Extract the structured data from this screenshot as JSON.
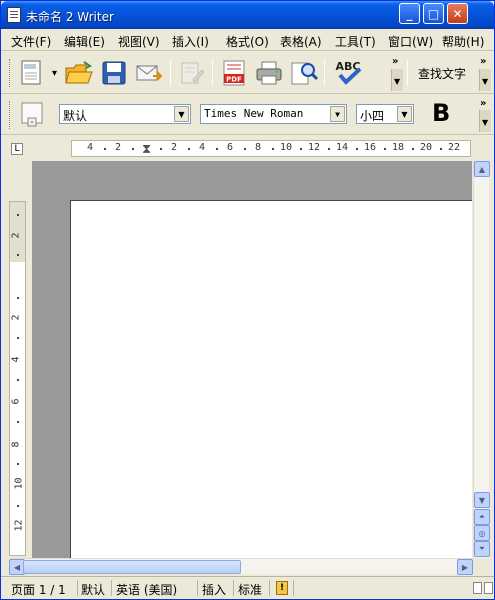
{
  "window": {
    "title": "未命名 2 Writer",
    "minimize": "_",
    "maximize": "□",
    "close": "✕"
  },
  "menu": {
    "items": [
      {
        "label": "文件(F)"
      },
      {
        "label": "编辑(E)"
      },
      {
        "label": "视图(V)"
      },
      {
        "label": "插入(I)"
      },
      {
        "label": "格式(O)"
      },
      {
        "label": "表格(A)"
      },
      {
        "label": "工具(T)"
      },
      {
        "label": "窗口(W)"
      },
      {
        "label": "帮助(H)"
      }
    ]
  },
  "standard_toolbar": {
    "new_icon": "new-document-icon",
    "open_icon": "open-folder-icon",
    "save_icon": "save-disk-icon",
    "email_icon": "email-icon",
    "edit_file_icon": "edit-file-icon",
    "pdf_label": "PDF",
    "print_icon": "printer-icon",
    "preview_icon": "page-preview-icon",
    "spellcheck_label": "ABC",
    "overflow": "»",
    "find_text_label": "查找文字"
  },
  "format_toolbar": {
    "styles_icon": "styles-icon",
    "paragraph_style": "默认",
    "font_name": "Times New Roman",
    "font_size": "小四",
    "bold_label": "B",
    "overflow": "»"
  },
  "ruler": {
    "h_labels": [
      "4",
      "2",
      "2",
      "4",
      "6",
      "8",
      "10",
      "12",
      "14",
      "16",
      "18",
      "20",
      "22"
    ],
    "v_labels": [
      "2",
      "2",
      "4",
      "6",
      "8",
      "10",
      "12"
    ],
    "tab_stop": "L"
  },
  "statusbar": {
    "page": "页面 1 / 1",
    "style": "默认",
    "language": "英语 (美国)",
    "mode": "插入",
    "selection": "标准"
  }
}
